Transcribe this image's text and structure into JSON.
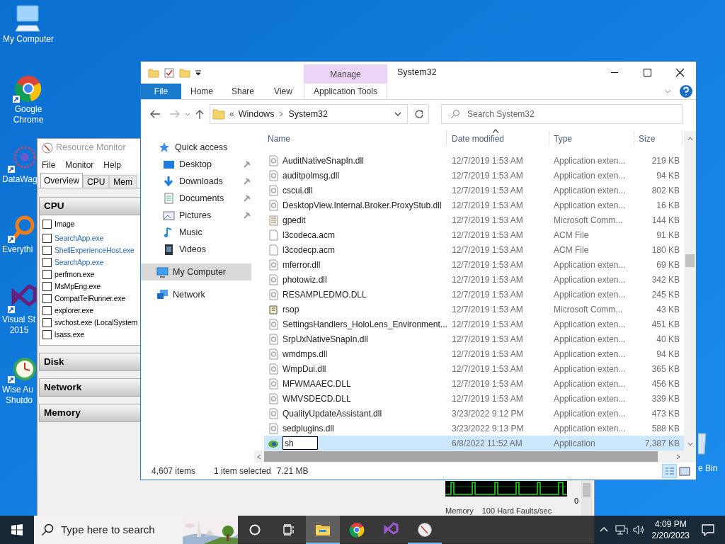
{
  "desktop": {
    "icons": [
      {
        "lines": [
          "My Computer"
        ],
        "kind": "computer"
      },
      {
        "lines": [
          "Google",
          "Chrome"
        ],
        "kind": "browser"
      },
      {
        "lines": [
          "DataWag"
        ],
        "kind": "network"
      },
      {
        "lines": [
          "Everythi"
        ],
        "kind": "magnifier"
      },
      {
        "lines": [
          "Visual St",
          "2015"
        ],
        "kind": "vs"
      },
      {
        "lines": [
          "Wise Au",
          "Shutdo"
        ],
        "kind": "clock"
      }
    ],
    "recycle_bin": {
      "label": "e Bin"
    }
  },
  "resource_monitor": {
    "title": "Resource Monitor",
    "menu": [
      "File",
      "Monitor",
      "Help"
    ],
    "tabs": [
      {
        "label": "Overview",
        "selected": true
      },
      {
        "label": "CPU",
        "selected": false
      },
      {
        "label": "Mem",
        "selected": false
      }
    ],
    "cpu": {
      "title": "CPU",
      "header": {
        "label": "Image",
        "checked": false
      },
      "rows": [
        {
          "name": "SearchApp.exe",
          "checked": false,
          "color": "#2b6cb0"
        },
        {
          "name": "ShellExperienceHost.exe",
          "checked": false,
          "color": "#2b6cb0"
        },
        {
          "name": "SearchApp.exe",
          "checked": false,
          "color": "#2b6cb0"
        },
        {
          "name": "perfmon.exe",
          "checked": false
        },
        {
          "name": "MsMpEng.exe",
          "checked": false
        },
        {
          "name": "CompatTelRunner.exe",
          "checked": false
        },
        {
          "name": "explorer.exe",
          "checked": false
        },
        {
          "name": "svchost.exe (LocalSystem",
          "checked": false
        },
        {
          "name": "lsass.exe",
          "checked": false
        }
      ]
    },
    "sections": [
      "Disk",
      "Network",
      "Memory"
    ],
    "graph": {
      "axis_label": "0",
      "title": "Memory",
      "reading": "100 Hard Faults/sec"
    }
  },
  "explorer": {
    "title": "System32",
    "contextual_group": "Manage",
    "ribbon_tabs": [
      {
        "label": "File",
        "kind": "file"
      },
      {
        "label": "Home",
        "kind": "plain"
      },
      {
        "label": "Share",
        "kind": "plain"
      },
      {
        "label": "View",
        "kind": "plain"
      },
      {
        "label": "Application Tools",
        "kind": "contextual"
      }
    ],
    "address": {
      "prefix": "«",
      "crumbs": [
        "Windows",
        "System32"
      ]
    },
    "search": {
      "placeholder": "Search System32"
    },
    "nav": [
      {
        "label": "Quick access",
        "kind": "star",
        "selected": false,
        "children": [
          {
            "label": "Desktop",
            "kind": "desktop",
            "pinned": true,
            "selected": false
          },
          {
            "label": "Downloads",
            "kind": "download",
            "pinned": true,
            "selected": false
          },
          {
            "label": "Documents",
            "kind": "document",
            "pinned": true,
            "selected": false
          },
          {
            "label": "Pictures",
            "kind": "picture",
            "pinned": true,
            "selected": false
          },
          {
            "label": "Music",
            "kind": "music",
            "pinned": false,
            "selected": false
          },
          {
            "label": "Videos",
            "kind": "video",
            "pinned": false,
            "selected": false
          }
        ]
      },
      {
        "label": "My Computer",
        "kind": "computer",
        "selected": true
      },
      {
        "label": "Network",
        "kind": "network",
        "selected": false
      }
    ],
    "columns": [
      {
        "label": "Name",
        "sorted": false
      },
      {
        "label": "Date modified",
        "sorted": true
      },
      {
        "label": "Type",
        "sorted": false
      },
      {
        "label": "Size",
        "sorted": false
      }
    ],
    "rows": [
      {
        "name": "AuditNativeSnapIn.dll",
        "kind": "dll",
        "date": "12/7/2019 1:53 AM",
        "type": "Application exten...",
        "size": "219 KB",
        "selected": false
      },
      {
        "name": "auditpolmsg.dll",
        "kind": "dll",
        "date": "12/7/2019 1:53 AM",
        "type": "Application exten...",
        "size": "94 KB",
        "selected": false
      },
      {
        "name": "cscui.dll",
        "kind": "dll",
        "date": "12/7/2019 1:53 AM",
        "type": "Application exten...",
        "size": "802 KB",
        "selected": false
      },
      {
        "name": "DesktopView.Internal.Broker.ProxyStub.dll",
        "kind": "dll",
        "date": "12/7/2019 1:53 AM",
        "type": "Application exten...",
        "size": "16 KB",
        "selected": false
      },
      {
        "name": "gpedit",
        "kind": "console",
        "date": "12/7/2019 1:53 AM",
        "type": "Microsoft Comm...",
        "size": "144 KB",
        "selected": false
      },
      {
        "name": "l3codeca.acm",
        "kind": "blank",
        "date": "12/7/2019 1:53 AM",
        "type": "ACM File",
        "size": "91 KB",
        "selected": false
      },
      {
        "name": "l3codecp.acm",
        "kind": "blank",
        "date": "12/7/2019 1:53 AM",
        "type": "ACM File",
        "size": "180 KB",
        "selected": false
      },
      {
        "name": "mferror.dll",
        "kind": "dll",
        "date": "12/7/2019 1:53 AM",
        "type": "Application exten...",
        "size": "69 KB",
        "selected": false
      },
      {
        "name": "photowiz.dll",
        "kind": "dll",
        "date": "12/7/2019 1:53 AM",
        "type": "Application exten...",
        "size": "342 KB",
        "selected": false
      },
      {
        "name": "RESAMPLEDMO.DLL",
        "kind": "dll",
        "date": "12/7/2019 1:53 AM",
        "type": "Application exten...",
        "size": "245 KB",
        "selected": false
      },
      {
        "name": "rsop",
        "kind": "scroll",
        "date": "12/7/2019 1:53 AM",
        "type": "Microsoft Comm...",
        "size": "43 KB",
        "selected": false
      },
      {
        "name": "SettingsHandlers_HoloLens_Environment...",
        "kind": "dll",
        "date": "12/7/2019 1:53 AM",
        "type": "Application exten...",
        "size": "451 KB",
        "selected": false
      },
      {
        "name": "SrpUxNativeSnapIn.dll",
        "kind": "dll",
        "date": "12/7/2019 1:53 AM",
        "type": "Application exten...",
        "size": "40 KB",
        "selected": false
      },
      {
        "name": "wmdmps.dll",
        "kind": "dll",
        "date": "12/7/2019 1:53 AM",
        "type": "Application exten...",
        "size": "94 KB",
        "selected": false
      },
      {
        "name": "WmpDui.dll",
        "kind": "dll",
        "date": "12/7/2019 1:53 AM",
        "type": "Application exten...",
        "size": "365 KB",
        "selected": false
      },
      {
        "name": "MFWMAAEC.DLL",
        "kind": "dll",
        "date": "12/7/2019 1:53 AM",
        "type": "Application exten...",
        "size": "456 KB",
        "selected": false
      },
      {
        "name": "WMVSDECD.DLL",
        "kind": "dll",
        "date": "12/7/2019 1:53 AM",
        "type": "Application exten...",
        "size": "339 KB",
        "selected": false
      },
      {
        "name": "QualityUpdateAssistant.dll",
        "kind": "dll",
        "date": "3/23/2022 9:12 PM",
        "type": "Application exten...",
        "size": "473 KB",
        "selected": false
      },
      {
        "name": "sedplugins.dll",
        "kind": "dll",
        "date": "3/23/2022 9:13 PM",
        "type": "Application exten...",
        "size": "588 KB",
        "selected": false
      },
      {
        "name": "sh",
        "kind": "app",
        "date": "6/8/2022 11:52 AM",
        "type": "Application",
        "size": "7,387 KB",
        "selected": true,
        "renaming": true
      }
    ],
    "status": {
      "items": "4,607 items",
      "selection": "1 item selected",
      "size": "7.21 MB"
    },
    "views": [
      {
        "kind": "details",
        "selected": true
      },
      {
        "kind": "thumbnails",
        "selected": false
      }
    ]
  },
  "taskbar": {
    "search": {
      "placeholder": "Type here to search"
    },
    "apps": [
      {
        "kind": "folder",
        "active": true,
        "running": true
      },
      {
        "kind": "browser",
        "active": false,
        "running": false
      },
      {
        "kind": "vs",
        "active": false,
        "running": false
      },
      {
        "kind": "gauge",
        "active": false,
        "running": true
      }
    ],
    "time": "4:09 PM",
    "date": "2/20/2023"
  }
}
